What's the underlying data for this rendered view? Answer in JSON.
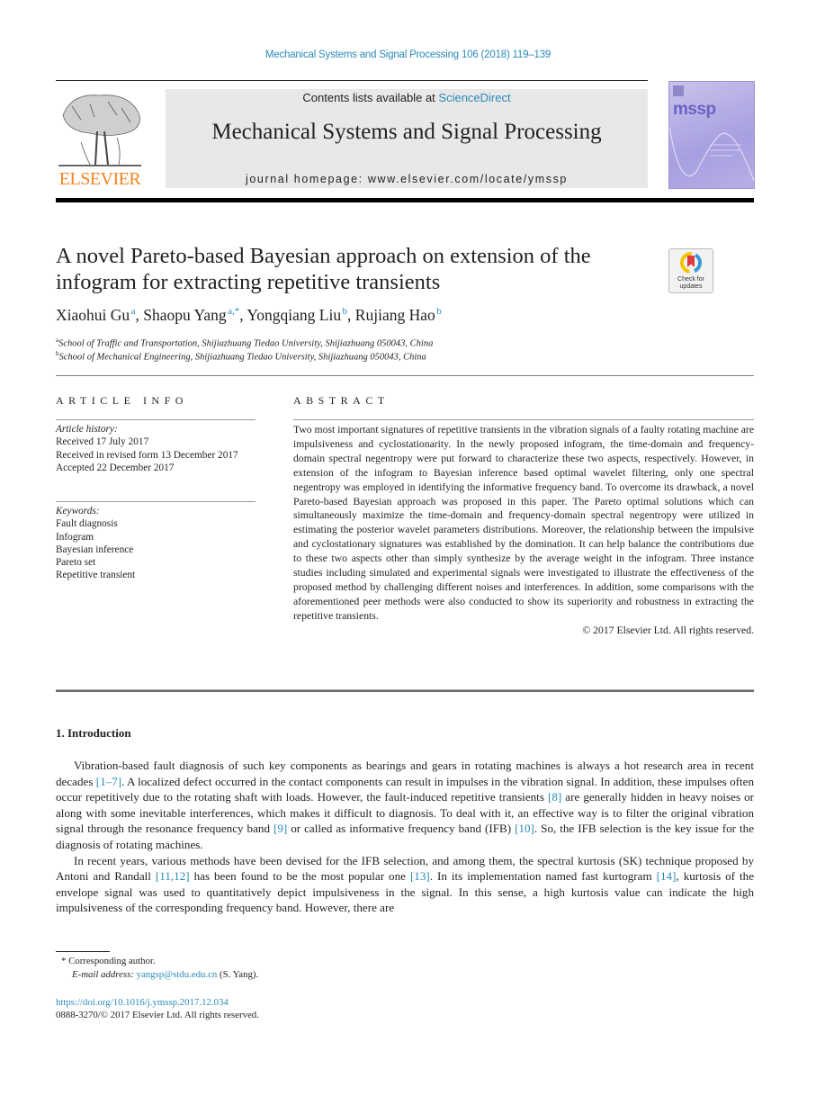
{
  "header": {
    "journal_reference": "Mechanical Systems and Signal Processing 106 (2018) 119–139",
    "contents_prefix": "Contents lists available at ",
    "contents_link": "ScienceDirect",
    "journal_title": "Mechanical Systems and Signal Processing",
    "homepage": "journal homepage: www.elsevier.com/locate/ymssp",
    "publisher_logo_text": "ELSEVIER",
    "cover_text": "mssp"
  },
  "article": {
    "title": "A novel Pareto-based Bayesian approach on extension of the infogram for extracting repetitive transients",
    "check_updates_label": "Check for updates",
    "authors": [
      {
        "name": "Xiaohui Gu",
        "sup": "a"
      },
      {
        "name": "Shaopu Yang",
        "sup": "a,*"
      },
      {
        "name": "Yongqiang Liu",
        "sup": "b"
      },
      {
        "name": "Rujiang Hao",
        "sup": "b"
      }
    ],
    "affiliations": [
      {
        "key": "a",
        "text": "School of Traffic and Transportation, Shijiazhuang Tiedao University, Shijiazhuang 050043, China"
      },
      {
        "key": "b",
        "text": "School of Mechanical Engineering, Shijiazhuang Tiedao University, Shijiazhuang 050043, China"
      }
    ]
  },
  "article_info": {
    "heading": "ARTICLE INFO",
    "history_label": "Article history:",
    "history": [
      "Received 17 July 2017",
      "Received in revised form 13 December 2017",
      "Accepted 22 December 2017"
    ],
    "keywords_label": "Keywords:",
    "keywords": [
      "Fault diagnosis",
      "Infogram",
      "Bayesian inference",
      "Pareto set",
      "Repetitive transient"
    ]
  },
  "abstract": {
    "heading": "ABSTRACT",
    "text": "Two most important signatures of repetitive transients in the vibration signals of a faulty rotating machine are impulsiveness and cyclostationarity. In the newly proposed infogram, the time-domain and frequency-domain spectral negentropy were put forward to characterize these two aspects, respectively. However, in extension of the infogram to Bayesian inference based optimal wavelet filtering, only one spectral negentropy was employed in identifying the informative frequency band. To overcome its drawback, a novel Pareto-based Bayesian approach was proposed in this paper. The Pareto optimal solutions which can simultaneously maximize the time-domain and frequency-domain spectral negentropy were utilized in estimating the posterior wavelet parameters distributions. Moreover, the relationship between the impulsive and cyclostationary signatures was established by the domination. It can help balance the contributions due to these two aspects other than simply synthesize by the average weight in the infogram. Three instance studies including simulated and experimental signals were investigated to illustrate the effectiveness of the proposed method by challenging different noises and interferences. In addition, some comparisons with the aforementioned peer methods were also conducted to show its superiority and robustness in extracting the repetitive transients.",
    "copyright": "© 2017 Elsevier Ltd. All rights reserved."
  },
  "introduction": {
    "heading": "1. Introduction",
    "p1": [
      {
        "t": "Vibration-based fault diagnosis of such key components as bearings and gears in rotating machines is always a hot research area in recent decades "
      },
      {
        "t": "[1–7]",
        "ref": true
      },
      {
        "t": ". A localized defect occurred in the contact components can result in impulses in the vibration signal. In addition, these impulses often occur repetitively due to the rotating shaft with loads. However, the fault-induced repetitive transients "
      },
      {
        "t": "[8]",
        "ref": true
      },
      {
        "t": " are generally hidden in heavy noises or along with some inevitable interferences, which makes it difficult to diagnosis. To deal with it, an effective way is to filter the original vibration signal through the resonance frequency band "
      },
      {
        "t": "[9]",
        "ref": true
      },
      {
        "t": " or called as informative frequency band (IFB) "
      },
      {
        "t": "[10]",
        "ref": true
      },
      {
        "t": ". So, the IFB selection is the key issue for the diagnosis of rotating machines."
      }
    ],
    "p2": [
      {
        "t": "In recent years, various methods have been devised for the IFB selection, and among them, the spectral kurtosis (SK) technique proposed by Antoni and Randall "
      },
      {
        "t": "[11,12]",
        "ref": true
      },
      {
        "t": " has been found to be the most popular one "
      },
      {
        "t": "[13]",
        "ref": true
      },
      {
        "t": ". In its implementation named fast kurtogram "
      },
      {
        "t": "[14]",
        "ref": true
      },
      {
        "t": ", kurtosis of the envelope signal was used to quantitatively depict impulsiveness in the signal. In this sense, a high kurtosis value can indicate the high impulsiveness of the corresponding frequency band. However, there are"
      }
    ]
  },
  "footnotes": {
    "corresponding": "* Corresponding author.",
    "email_label": "E-mail address: ",
    "email": "yangsp@stdu.edu.cn",
    "email_suffix": " (S. Yang).",
    "doi": "https://doi.org/10.1016/j.ymssp.2017.12.034",
    "issn_copyright": "0888-3270/© 2017 Elsevier Ltd. All rights reserved."
  },
  "colors": {
    "link": "#2a8ab9",
    "elsevier_orange": "#f58220",
    "banner_gray": "#e8e8e8",
    "cover_purple": "#a79fe0"
  }
}
